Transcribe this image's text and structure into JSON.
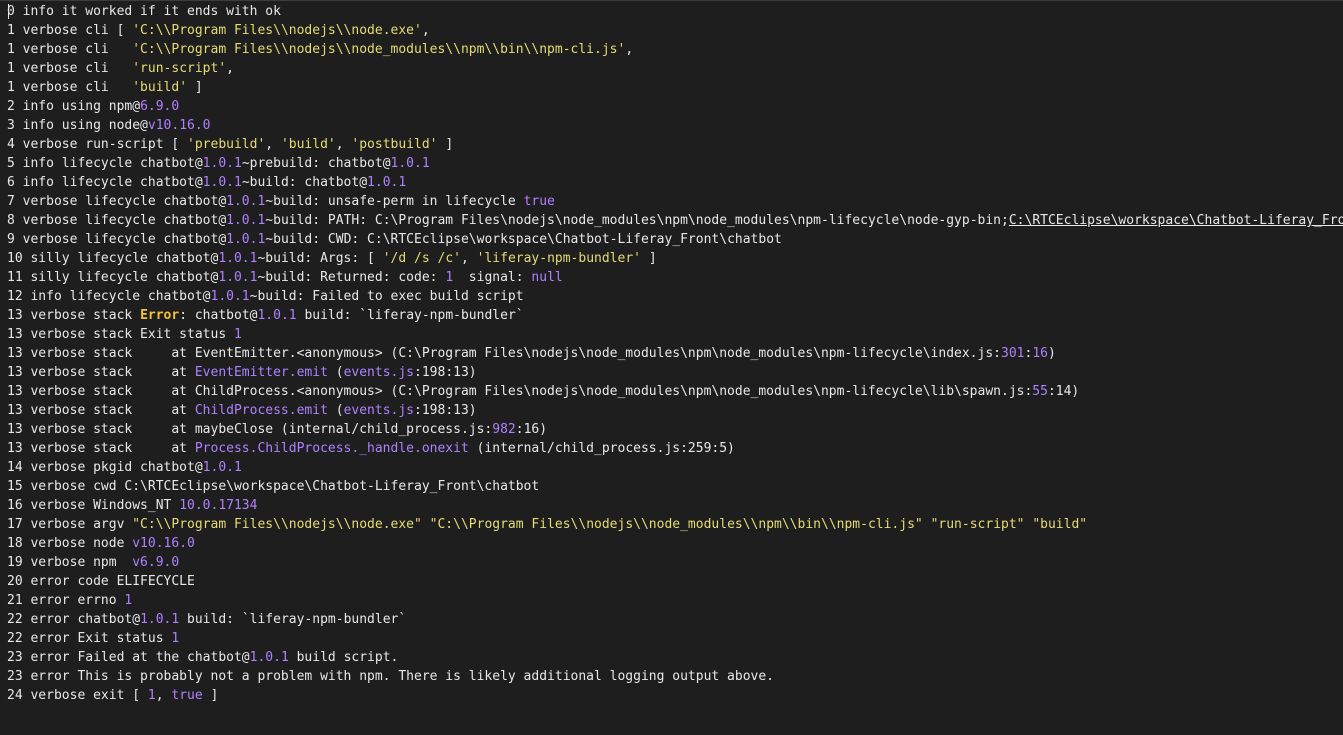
{
  "log_lines": [
    [
      {
        "t": "0 info it worked if it ends with ok",
        "c": ""
      }
    ],
    [
      {
        "t": "1 verbose cli [ ",
        "c": ""
      },
      {
        "t": "'C:\\\\Program Files\\\\nodejs\\\\node.exe'",
        "c": "str"
      },
      {
        "t": ",",
        "c": ""
      }
    ],
    [
      {
        "t": "1 verbose cli   ",
        "c": ""
      },
      {
        "t": "'C:\\\\Program Files\\\\nodejs\\\\node_modules\\\\npm\\\\bin\\\\npm-cli.js'",
        "c": "str"
      },
      {
        "t": ",",
        "c": ""
      }
    ],
    [
      {
        "t": "1 verbose cli   ",
        "c": ""
      },
      {
        "t": "'run-script'",
        "c": "str"
      },
      {
        "t": ",",
        "c": ""
      }
    ],
    [
      {
        "t": "1 verbose cli   ",
        "c": ""
      },
      {
        "t": "'build'",
        "c": "str"
      },
      {
        "t": " ]",
        "c": ""
      }
    ],
    [
      {
        "t": "2 info using npm@",
        "c": ""
      },
      {
        "t": "6.9.0",
        "c": "ver"
      }
    ],
    [
      {
        "t": "3 info using node@",
        "c": ""
      },
      {
        "t": "v10.16.0",
        "c": "ver"
      }
    ],
    [
      {
        "t": "4 verbose run-script [ ",
        "c": ""
      },
      {
        "t": "'prebuild'",
        "c": "str"
      },
      {
        "t": ", ",
        "c": ""
      },
      {
        "t": "'build'",
        "c": "str"
      },
      {
        "t": ", ",
        "c": ""
      },
      {
        "t": "'postbuild'",
        "c": "str"
      },
      {
        "t": " ]",
        "c": ""
      }
    ],
    [
      {
        "t": "5 info lifecycle chatbot@",
        "c": ""
      },
      {
        "t": "1.0.1",
        "c": "ver"
      },
      {
        "t": "~prebuild: chatbot@",
        "c": ""
      },
      {
        "t": "1.0.1",
        "c": "ver"
      }
    ],
    [
      {
        "t": "6 info lifecycle chatbot@",
        "c": ""
      },
      {
        "t": "1.0.1",
        "c": "ver"
      },
      {
        "t": "~build: chatbot@",
        "c": ""
      },
      {
        "t": "1.0.1",
        "c": "ver"
      }
    ],
    [
      {
        "t": "7 verbose lifecycle chatbot@",
        "c": ""
      },
      {
        "t": "1.0.1",
        "c": "ver"
      },
      {
        "t": "~build: unsafe-perm in lifecycle ",
        "c": ""
      },
      {
        "t": "true",
        "c": "kw"
      }
    ],
    [
      {
        "t": "8 verbose lifecycle chatbot@",
        "c": ""
      },
      {
        "t": "1.0.1",
        "c": "ver"
      },
      {
        "t": "~build: PATH: C:\\Program Files\\nodejs\\node_modules\\npm\\node_modules\\npm-lifecycle\\node-gyp-bin;",
        "c": ""
      },
      {
        "t": "C:\\RTCEclipse\\workspace\\Chatbot-Liferay_Front\\",
        "c": "link"
      }
    ],
    [
      {
        "t": "9 verbose lifecycle chatbot@",
        "c": ""
      },
      {
        "t": "1.0.1",
        "c": "ver"
      },
      {
        "t": "~build: CWD: C:\\RTCEclipse\\workspace\\Chatbot-Liferay_Front\\chatbot",
        "c": ""
      }
    ],
    [
      {
        "t": "10 silly lifecycle chatbot@",
        "c": ""
      },
      {
        "t": "1.0.1",
        "c": "ver"
      },
      {
        "t": "~build: Args: [ ",
        "c": ""
      },
      {
        "t": "'/d /s /c'",
        "c": "str"
      },
      {
        "t": ", ",
        "c": ""
      },
      {
        "t": "'liferay-npm-bundler'",
        "c": "str"
      },
      {
        "t": " ]",
        "c": ""
      }
    ],
    [
      {
        "t": "11 silly lifecycle chatbot@",
        "c": ""
      },
      {
        "t": "1.0.1",
        "c": "ver"
      },
      {
        "t": "~build: Returned: code: ",
        "c": ""
      },
      {
        "t": "1",
        "c": "num"
      },
      {
        "t": "  signal: ",
        "c": ""
      },
      {
        "t": "null",
        "c": "kw"
      }
    ],
    [
      {
        "t": "12 info lifecycle chatbot@",
        "c": ""
      },
      {
        "t": "1.0.1",
        "c": "ver"
      },
      {
        "t": "~build: Failed to exec build script",
        "c": ""
      }
    ],
    [
      {
        "t": "13 verbose stack ",
        "c": ""
      },
      {
        "t": "Error",
        "c": "err"
      },
      {
        "t": ": chatbot@",
        "c": ""
      },
      {
        "t": "1.0.1",
        "c": "ver"
      },
      {
        "t": " build: `liferay-npm-bundler`",
        "c": ""
      }
    ],
    [
      {
        "t": "13 verbose stack Exit status ",
        "c": ""
      },
      {
        "t": "1",
        "c": "num"
      }
    ],
    [
      {
        "t": "13 verbose stack     at EventEmitter.<anonymous> (C:\\Program Files\\nodejs\\node_modules\\npm\\node_modules\\npm-lifecycle\\index.js:",
        "c": ""
      },
      {
        "t": "301",
        "c": "num"
      },
      {
        "t": ":",
        "c": ""
      },
      {
        "t": "16",
        "c": "num"
      },
      {
        "t": ")",
        "c": ""
      }
    ],
    [
      {
        "t": "13 verbose stack     at ",
        "c": ""
      },
      {
        "t": "EventEmitter.emit",
        "c": "fn"
      },
      {
        "t": " (",
        "c": ""
      },
      {
        "t": "events.js",
        "c": "fn"
      },
      {
        "t": ":198:13)",
        "c": ""
      }
    ],
    [
      {
        "t": "13 verbose stack     at ChildProcess.<anonymous> (C:\\Program Files\\nodejs\\node_modules\\npm\\node_modules\\npm-lifecycle\\lib\\spawn.js:",
        "c": ""
      },
      {
        "t": "55",
        "c": "num"
      },
      {
        "t": ":14)",
        "c": ""
      }
    ],
    [
      {
        "t": "13 verbose stack     at ",
        "c": ""
      },
      {
        "t": "ChildProcess.emit",
        "c": "fn"
      },
      {
        "t": " (",
        "c": ""
      },
      {
        "t": "events.js",
        "c": "fn"
      },
      {
        "t": ":198:13)",
        "c": ""
      }
    ],
    [
      {
        "t": "13 verbose stack     at maybeClose (internal/child_process.js:",
        "c": ""
      },
      {
        "t": "982",
        "c": "num"
      },
      {
        "t": ":16)",
        "c": ""
      }
    ],
    [
      {
        "t": "13 verbose stack     at ",
        "c": ""
      },
      {
        "t": "Process.ChildProcess._handle.onexit",
        "c": "fn"
      },
      {
        "t": " (internal/child_process.js:259:5)",
        "c": ""
      }
    ],
    [
      {
        "t": "14 verbose pkgid chatbot@",
        "c": ""
      },
      {
        "t": "1.0.1",
        "c": "ver"
      }
    ],
    [
      {
        "t": "15 verbose cwd C:\\RTCEclipse\\workspace\\Chatbot-Liferay_Front\\chatbot",
        "c": ""
      }
    ],
    [
      {
        "t": "16 verbose Windows_NT ",
        "c": ""
      },
      {
        "t": "10.0.17134",
        "c": "ver"
      }
    ],
    [
      {
        "t": "17 verbose argv ",
        "c": ""
      },
      {
        "t": "\"C:\\\\Program Files\\\\nodejs\\\\node.exe\"",
        "c": "str"
      },
      {
        "t": " ",
        "c": ""
      },
      {
        "t": "\"C:\\\\Program Files\\\\nodejs\\\\node_modules\\\\npm\\\\bin\\\\npm-cli.js\"",
        "c": "str"
      },
      {
        "t": " ",
        "c": ""
      },
      {
        "t": "\"run-script\"",
        "c": "str"
      },
      {
        "t": " ",
        "c": ""
      },
      {
        "t": "\"build\"",
        "c": "str"
      }
    ],
    [
      {
        "t": "18 verbose node ",
        "c": ""
      },
      {
        "t": "v10.16.0",
        "c": "ver"
      }
    ],
    [
      {
        "t": "19 verbose npm  ",
        "c": ""
      },
      {
        "t": "v6.9.0",
        "c": "ver"
      }
    ],
    [
      {
        "t": "20 error code ELIFECYCLE",
        "c": ""
      }
    ],
    [
      {
        "t": "21 error errno ",
        "c": ""
      },
      {
        "t": "1",
        "c": "num"
      }
    ],
    [
      {
        "t": "22 error chatbot@",
        "c": ""
      },
      {
        "t": "1.0.1",
        "c": "ver"
      },
      {
        "t": " build: `liferay-npm-bundler`",
        "c": ""
      }
    ],
    [
      {
        "t": "22 error Exit status ",
        "c": ""
      },
      {
        "t": "1",
        "c": "num"
      }
    ],
    [
      {
        "t": "23 error Failed at the chatbot@",
        "c": ""
      },
      {
        "t": "1.0.1",
        "c": "ver"
      },
      {
        "t": " build script.",
        "c": ""
      }
    ],
    [
      {
        "t": "23 error This is probably not a problem with npm. There is likely additional logging output above.",
        "c": ""
      }
    ],
    [
      {
        "t": "24 verbose exit [ ",
        "c": ""
      },
      {
        "t": "1",
        "c": "num"
      },
      {
        "t": ", ",
        "c": ""
      },
      {
        "t": "true",
        "c": "kw"
      },
      {
        "t": " ]",
        "c": ""
      }
    ]
  ],
  "colors": {
    "background": "#1e1e1e",
    "text": "#e8e8e8",
    "string": "#e6db74",
    "literal": "#ae81ff",
    "error": "#f1c232"
  }
}
